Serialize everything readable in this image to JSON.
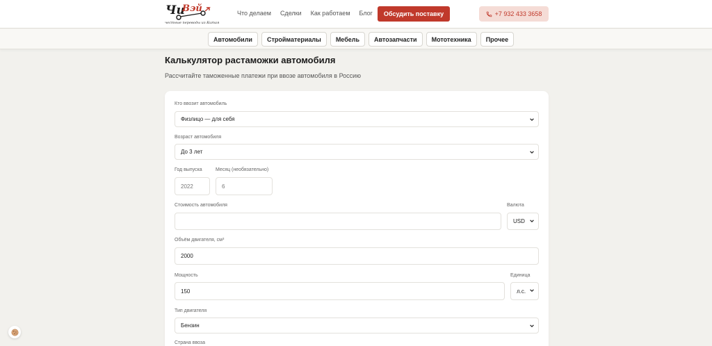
{
  "header": {
    "logo_text": "ЧиВэй",
    "logo_tagline": "честные переводы из Китая",
    "nav": [
      "Что делаем",
      "Сделки",
      "Как работаем",
      "Блог"
    ],
    "cta_label": "Обсудить поставку",
    "phone": "+7 932 433 3658",
    "brand_color": "#c0392b"
  },
  "categories": [
    "Автомобили",
    "Стройматериалы",
    "Мебель",
    "Автозапчасти",
    "Мототехника",
    "Прочее"
  ],
  "page": {
    "title": "Калькулятор растаможки автомобиля",
    "subtitle": "Рассчитайте таможенные платежи при ввозе автомобиля в Россию"
  },
  "form": {
    "importer": {
      "label": "Кто ввозит автомобиль",
      "value": "Физлицо — для себя"
    },
    "age": {
      "label": "Возраст автомобиля",
      "value": "До 3 лет"
    },
    "year": {
      "label": "Год выпуска",
      "value": "2022"
    },
    "month": {
      "label": "Месяц (необязательно)",
      "value": "6"
    },
    "price": {
      "label": "Стоимость автомобиля",
      "value": ""
    },
    "currency": {
      "label": "Валюта",
      "value": "USD"
    },
    "engine_volume": {
      "label": "Объём двигателя, см³",
      "value": "2000"
    },
    "power": {
      "label": "Мощность",
      "value": "150"
    },
    "power_unit": {
      "label": "Единица",
      "value": "л.с."
    },
    "engine_type": {
      "label": "Тип двигателя",
      "value": "Бензин"
    },
    "country": {
      "label": "Страна ввоза"
    }
  },
  "icons": {
    "phone": "phone-icon",
    "chevron": "chevron-down-icon",
    "cookie": "cookie-icon"
  }
}
